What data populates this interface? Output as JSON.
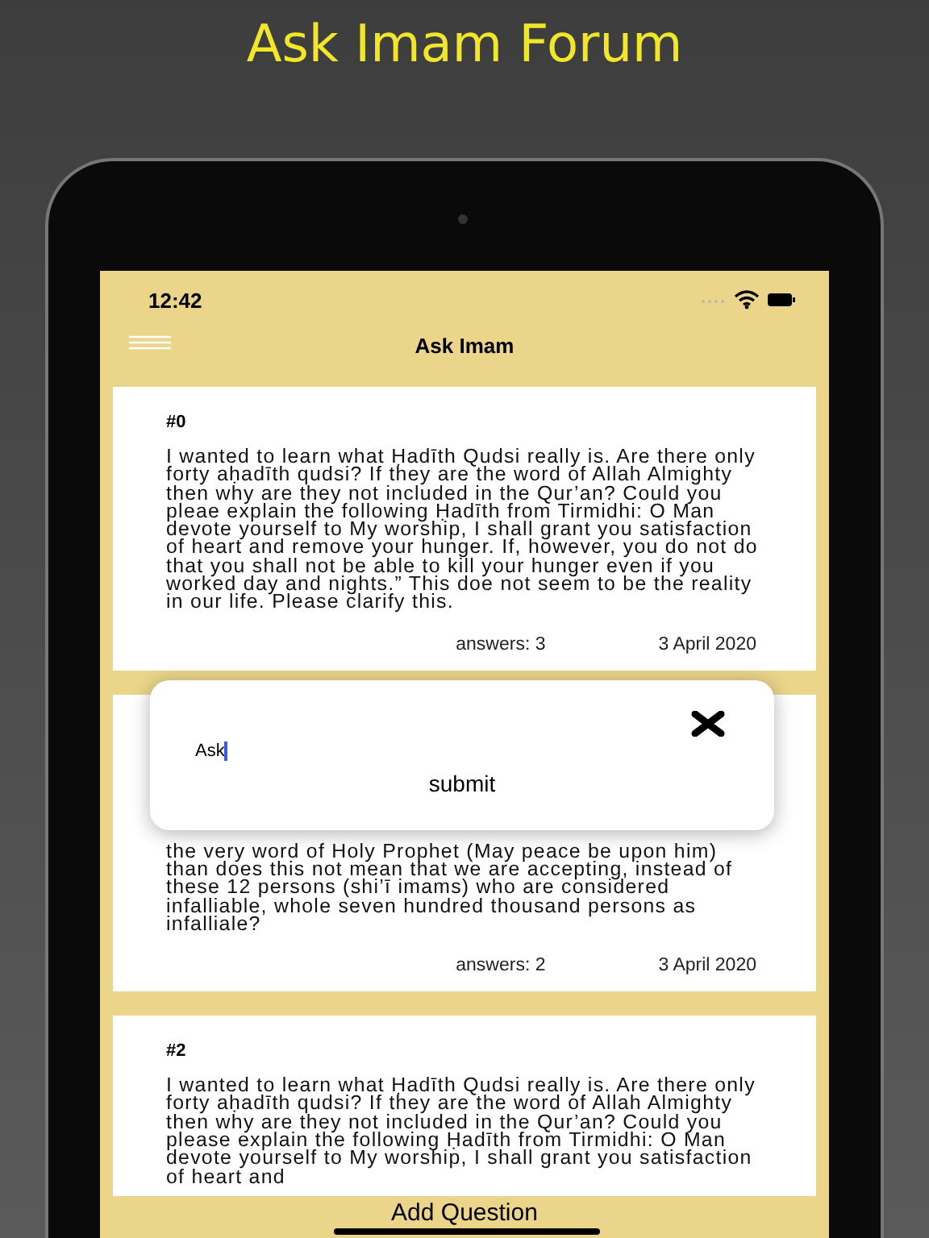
{
  "headline": "Ask Imam Forum",
  "status_bar": {
    "time": "12:42"
  },
  "nav": {
    "title": "Ask Imam"
  },
  "questions": [
    {
      "number": "#0",
      "text": "I wanted to learn what Ḥadīth Qudsi really is. Are there only forty aḥadīth qudsi? If they are the word of Allah Almighty then why are they not included in the Qur’an? Could you pleae explain the following Ḥadīth from Tirmidhi: O Man devote yourself to My worship, I shall grant you satisfaction of heart and remove your hunger. If, however, you do not do that you shall not be able to kill your hunger even if you worked day and nights.” This doe not seem to be the reality in our life. Please clarify this.",
      "answers": "answers: 3",
      "date": "3 April 2020"
    },
    {
      "text": "the very word of Holy Prophet (May peace be upon him) than does this not mean that we are accepting, instead of these 12 persons (shi’ī imams) who are considered infalliable, whole seven hundred thousand persons as infalliale?",
      "answers": "answers: 2",
      "date": "3 April 2020"
    },
    {
      "number": "#2",
      "text": "I wanted to learn what Ḥadīth Qudsi really is. Are there only forty aḥadīth qudsi? If they are the word of Allah Almighty then why are they not included in the Qur’an? Could you please explain the following Ḥadīth from Tirmidhi: O Man devote yourself to My worship, I shall grant you satisfaction of heart and"
    }
  ],
  "dialog": {
    "value": "Ask",
    "submit": "submit"
  },
  "bottom_bar": {
    "label": "Add Question"
  }
}
